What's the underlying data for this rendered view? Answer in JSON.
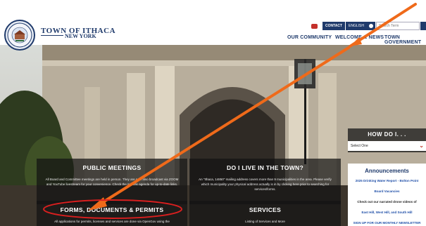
{
  "brand": {
    "name_line1": "TOWN OF ITHACA",
    "name_line2": "NEW YORK",
    "seal_top": "TOWN OF ITHACA",
    "seal_bottom": "NEW YORK"
  },
  "utility": {
    "contact": "CONTACT",
    "language": "ENGLISH",
    "search_placeholder": "Search Term"
  },
  "nav": {
    "items": [
      "OUR COMMUNITY",
      "WELCOME & NEWS",
      "TOWN GOVERNMENT"
    ]
  },
  "panels": {
    "public_meetings": {
      "title": "PUBLIC MEETINGS",
      "text": "All Board and Committee meetings are held in person. They are now also broadcast via ZOOM and YouTube livestream for your convenience. Check the specific agenda for up-to-date links."
    },
    "live_in_town": {
      "title": "DO I LIVE IN THE TOWN?",
      "text": "An \"Ithaca, 14850\" mailing address covers more than 9 municipalities in the area. Please verify which municipality your physical address actually is in by clicking here prior to searching for services/forms."
    },
    "forms": {
      "title": "FORMS, DOCUMENTS & PERMITS",
      "text": "All applications for permits, licenses and services are done via OpenGov using the"
    },
    "services": {
      "title": "SERVICES",
      "text": "Listing of Services and More"
    }
  },
  "howdo": {
    "title": "HOW DO I. . .",
    "select_value": "Select One"
  },
  "announcements": {
    "title": "Announcements",
    "items": [
      {
        "text": "2025 Drinking Water Report - Bolton Point",
        "color": "#1f4fa8"
      },
      {
        "text": "Board Vacancies",
        "color": "#1f4fa8"
      },
      {
        "text": "Check out our narrated drone videos of",
        "color": "#222222"
      },
      {
        "text": "East Hill, West Hill, and South Hill",
        "color": "#1f4fa8"
      },
      {
        "text": "SIGN UP FOR OUR MONTHLY NEWSLETTER",
        "color": "#1f4fa8"
      }
    ]
  },
  "colors": {
    "navy": "#1f3a6b",
    "annotation_orange": "#ef6a1a",
    "annotation_red": "#d91f1f"
  },
  "icons": [
    "seal-logo",
    "youtube-icon",
    "globe-icon",
    "search-icon",
    "chevron-down-icon"
  ]
}
